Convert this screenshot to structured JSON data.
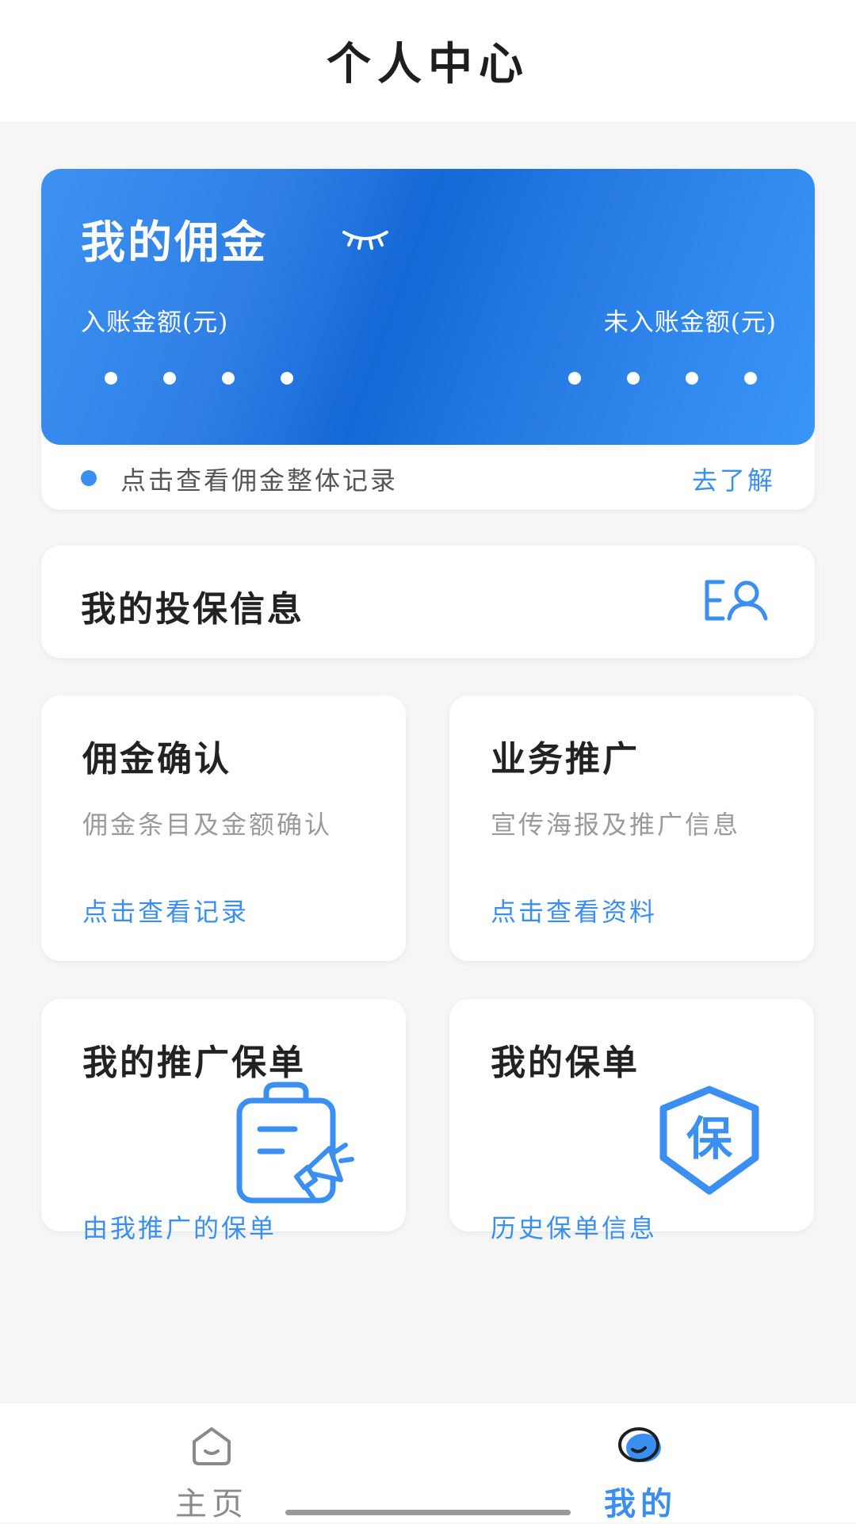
{
  "header": {
    "title": "个人中心"
  },
  "commission": {
    "title": "我的佣金",
    "eye_icon": "eye-closed-icon",
    "credited_label": "入账金额(元)",
    "uncredited_label": "未入账金额(元)",
    "record_text": "点击查看佣金整体记录",
    "learn_link": "去了解"
  },
  "insurance_info": {
    "title": "我的投保信息",
    "icon": "profile-list-icon"
  },
  "cards": [
    {
      "title": "佣金确认",
      "desc": "佣金条目及金额确认",
      "link": "点击查看记录"
    },
    {
      "title": "业务推广",
      "desc": "宣传海报及推广信息",
      "link": "点击查看资料"
    },
    {
      "title": "我的推广保单",
      "link": "由我推广的保单",
      "icon": "clipboard-megaphone-icon"
    },
    {
      "title": "我的保单",
      "link": "历史保单信息",
      "icon": "shield-bao-icon",
      "icon_text": "保"
    }
  ],
  "nav": {
    "items": [
      {
        "label": "主页",
        "icon": "home-face-icon",
        "active": false
      },
      {
        "label": "我的",
        "icon": "mine-face-icon",
        "active": true
      }
    ]
  },
  "colors": {
    "accent": "#3b8ff0",
    "gradient_dark": "#1569d6",
    "background": "#f6f6f6"
  }
}
